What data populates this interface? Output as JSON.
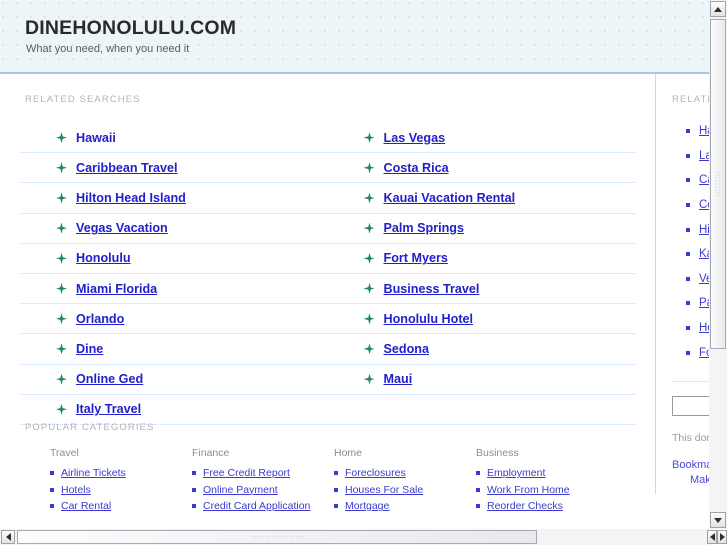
{
  "header": {
    "title": "DINEHONOLULU.COM",
    "tagline": "What you need, when you need it"
  },
  "related_searches": {
    "label": "RELATED SEARCHES",
    "left": [
      "Hawaii",
      "Caribbean Travel",
      "Hilton Head Island",
      "Vegas Vacation",
      "Honolulu",
      "Miami Florida",
      "Orlando",
      "Dine",
      "Online Ged",
      "Italy Travel"
    ],
    "right": [
      "Las Vegas",
      "Costa Rica",
      "Kauai Vacation Rental",
      "Palm Springs",
      "Fort Myers",
      "Business Travel",
      "Honolulu Hotel",
      "Sedona",
      "Maui"
    ],
    "bullet_icon": "sparkle-icon"
  },
  "popular_categories": {
    "label": "POPULAR CATEGORIES",
    "columns": [
      {
        "title": "Travel",
        "links": [
          "Airline Tickets",
          "Hotels",
          "Car Rental"
        ]
      },
      {
        "title": "Finance",
        "links": [
          "Free Credit Report",
          "Online Payment",
          "Credit Card Application"
        ]
      },
      {
        "title": "Home",
        "links": [
          "Foreclosures",
          "Houses For Sale",
          "Mortgage"
        ]
      },
      {
        "title": "Business",
        "links": [
          "Employment",
          "Work From Home",
          "Reorder Checks"
        ]
      }
    ]
  },
  "sidebar": {
    "label": "RELATED SEARCHES",
    "links": [
      "Hawaii",
      "Las Vegas",
      "Caribbean Travel",
      "Costa Rica",
      "Hilton Head Island",
      "Kauai Vacation Rental",
      "Vegas Vacation",
      "Palm Springs",
      "Honolulu",
      "Fort Myers"
    ],
    "search_placeholder": "",
    "search_value": "",
    "domain_note": "This domain may be for sale",
    "actions": [
      "Bookmark this page",
      "Make this my homepage"
    ]
  },
  "colors": {
    "link": "#2020cc",
    "sidebar_link": "#3a3ad0",
    "header_bg": "#eef5f9",
    "header_rule": "#aac6dd",
    "label_gray": "#b4b4b4",
    "sparkle_green": "#1f8a5c"
  },
  "scrollbars": {
    "vertical": {
      "up": "scroll-up-arrow",
      "down": "scroll-down-arrow"
    },
    "horizontal": {
      "left": "scroll-left-arrow",
      "right": "scroll-right-arrow"
    }
  }
}
